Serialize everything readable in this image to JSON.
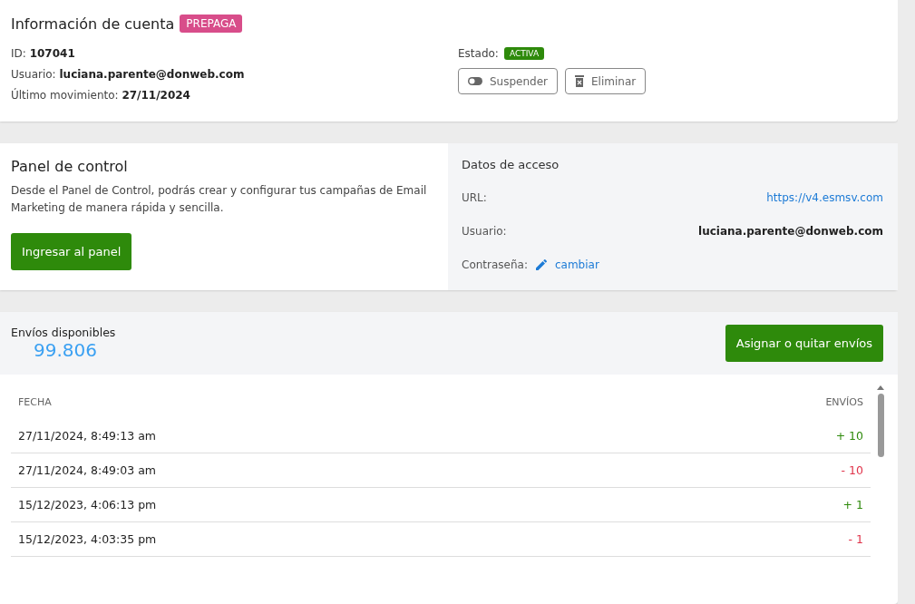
{
  "account": {
    "title": "Información de cuenta",
    "badge": "PREPAGA",
    "fields": [
      {
        "label": "ID:",
        "value": "107041"
      },
      {
        "label": "Usuario:",
        "value": "luciana.parente@donweb.com"
      },
      {
        "label": "Último movimiento:",
        "value": "27/11/2024"
      }
    ],
    "status": {
      "label": "Estado:",
      "value": "ACTIVA"
    },
    "actions": [
      {
        "kind": "toggle",
        "label": "Suspender"
      },
      {
        "kind": "trash",
        "label": "Eliminar"
      }
    ]
  },
  "panel": {
    "title": "Panel de control",
    "description": "Desde el Panel de Control, podrás crear y configurar tus campañas de Email Marketing de manera rápida y sencilla.",
    "button": "Ingresar al panel"
  },
  "access": {
    "title": "Datos de acceso",
    "url_label": "URL:",
    "url": "https://v4.esmsv.com",
    "user_label": "Usuario:",
    "user": "luciana.parente@donweb.com",
    "password_label": "Contraseña:",
    "password_action": "cambiar"
  },
  "sends": {
    "label": "Envíos disponibles",
    "count": "99.806",
    "button": "Asignar o quitar envíos",
    "table": {
      "columns": [
        "FECHA",
        "ENVÍOS"
      ],
      "rows": [
        {
          "date": "27/11/2024, 8:49:13 am",
          "amount": "+ 10",
          "kind": "credit"
        },
        {
          "date": "27/11/2024, 8:49:03 am",
          "amount": "- 10",
          "kind": "debit"
        },
        {
          "date": "15/12/2023, 4:06:13 pm",
          "amount": "+ 1",
          "kind": "credit"
        },
        {
          "date": "15/12/2023, 4:03:35 pm",
          "amount": "- 1",
          "kind": "debit"
        }
      ]
    }
  }
}
